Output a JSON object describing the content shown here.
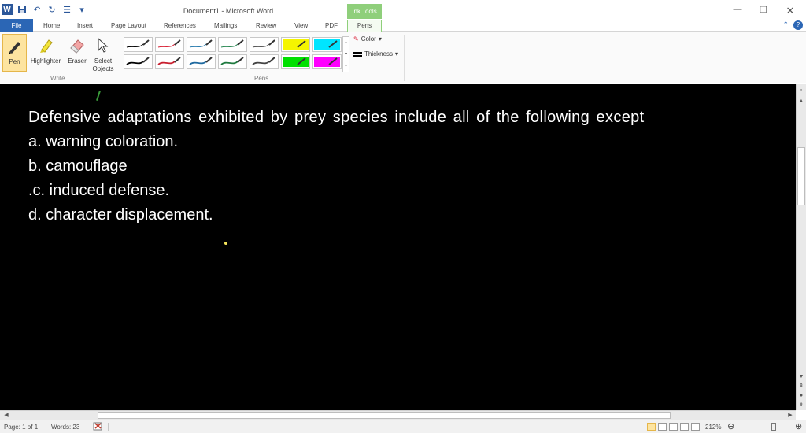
{
  "window": {
    "title": "Document1 - Microsoft Word",
    "contextual_tab_group": "Ink Tools"
  },
  "tabs": [
    {
      "label": "File"
    },
    {
      "label": "Home"
    },
    {
      "label": "Insert"
    },
    {
      "label": "Page Layout"
    },
    {
      "label": "References"
    },
    {
      "label": "Mailings"
    },
    {
      "label": "Review"
    },
    {
      "label": "View"
    },
    {
      "label": "PDF"
    },
    {
      "label": "Pens"
    }
  ],
  "active_tab": "Pens",
  "ribbon": {
    "write_group": {
      "label": "Write",
      "pen": "Pen",
      "highlighter": "Highlighter",
      "eraser": "Eraser",
      "select_objects": "Select Objects"
    },
    "pens_group": {
      "label": "Pens",
      "pen_styles": [
        {
          "color": "#000000"
        },
        {
          "color": "#d9263a"
        },
        {
          "color": "#2e7fb0"
        },
        {
          "color": "#2e8b57"
        },
        {
          "color": "#555555"
        },
        {
          "color": "#f5f500"
        },
        {
          "color": "#00e5ff"
        },
        {
          "color": "#000000"
        },
        {
          "color": "#c81e2e"
        },
        {
          "color": "#1f6aa0"
        },
        {
          "color": "#1f7a3f"
        },
        {
          "color": "#444444"
        },
        {
          "color": "#00e000"
        },
        {
          "color": "#ff00ff"
        }
      ],
      "color_label": "Color",
      "thickness_label": "Thickness"
    }
  },
  "document": {
    "lines": [
      "Defensive adaptations exhibited by prey species include all of the following except",
      "a. warning coloration.",
      "b. camouflage",
      ".c. induced defense.",
      "d. character displacement."
    ]
  },
  "status_bar": {
    "page": "Page: 1 of 1",
    "words": "Words: 23",
    "zoom": "212%"
  },
  "colors": {
    "accent": "#2b66b5",
    "contextual": "#8fcf7b",
    "active_button": "#fde4a0",
    "document_background": "#000000",
    "document_text": "#ffffff"
  }
}
